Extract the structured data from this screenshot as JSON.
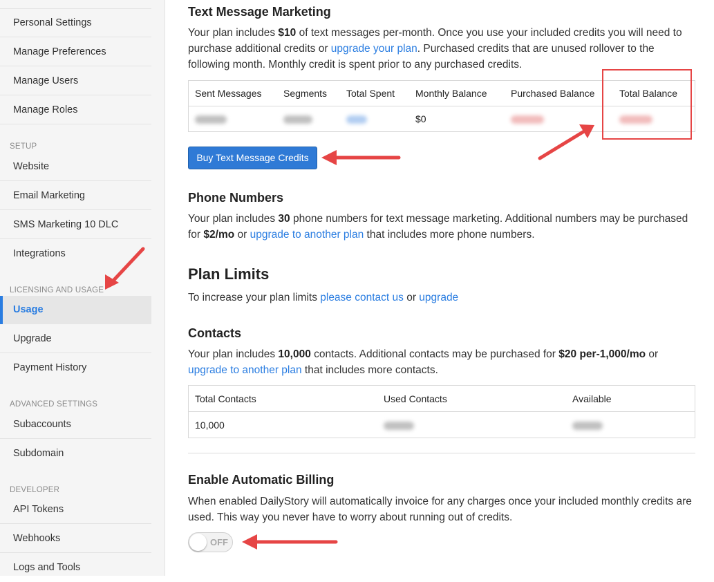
{
  "sidebar": {
    "items_top": [
      "Personal Settings",
      "Manage Preferences",
      "Manage Users",
      "Manage Roles"
    ],
    "setup_label": "SETUP",
    "setup_items": [
      "Website",
      "Email Marketing",
      "SMS Marketing 10 DLC",
      "Integrations"
    ],
    "licensing_label": "LICENSING AND USAGE",
    "licensing_items": [
      "Usage",
      "Upgrade",
      "Payment History"
    ],
    "advanced_label": "ADVANCED SETTINGS",
    "advanced_items": [
      "Subaccounts",
      "Subdomain"
    ],
    "developer_label": "DEVELOPER",
    "developer_items": [
      "API Tokens",
      "Webhooks",
      "Logs and Tools"
    ],
    "active_item": "Usage"
  },
  "sms": {
    "title": "Text Message Marketing",
    "p_pre": "Your plan includes ",
    "p_amount": "$10",
    "p_mid": " of text messages per-month. Once you use your included credits you will need to purchase additional credits or ",
    "p_link": "upgrade your plan",
    "p_post": ". Purchased credits that are unused rollover to the following month. Monthly credit is spent prior to any purchased credits.",
    "table_headers": [
      "Sent Messages",
      "Segments",
      "Total Spent",
      "Monthly Balance",
      "Purchased Balance",
      "Total Balance"
    ],
    "monthly_balance": "$0",
    "buy_button": "Buy Text Message Credits"
  },
  "phone": {
    "title": "Phone Numbers",
    "p_pre": "Your plan includes ",
    "p_count": "30",
    "p_mid": " phone numbers for text message marketing. Additional numbers may be purchased for ",
    "p_price": "$2/mo",
    "p_or": " or ",
    "p_link": "upgrade to another plan",
    "p_post": " that includes more phone numbers."
  },
  "limits": {
    "title": "Plan Limits",
    "p_pre": "To increase your plan limits ",
    "p_link1": "please contact us",
    "p_or": " or ",
    "p_link2": "upgrade"
  },
  "contacts": {
    "title": "Contacts",
    "p_pre": "Your plan includes ",
    "p_count": "10,000",
    "p_mid": " contacts. Additional contacts may be purchased for ",
    "p_price": "$20 per-1,000/mo",
    "p_or": " or ",
    "p_link": "upgrade to another plan",
    "p_post": " that includes more contacts.",
    "table_headers": [
      "Total Contacts",
      "Used Contacts",
      "Available"
    ],
    "total_contacts": "10,000"
  },
  "billing": {
    "title": "Enable Automatic Billing",
    "p": "When enabled DailyStory will automatically invoice for any charges once your included monthly credits are used. This way you never have to worry about running out of credits.",
    "toggle_label": "OFF"
  },
  "colors": {
    "accent": "#2a7de1",
    "annotation_red": "#e64545"
  }
}
